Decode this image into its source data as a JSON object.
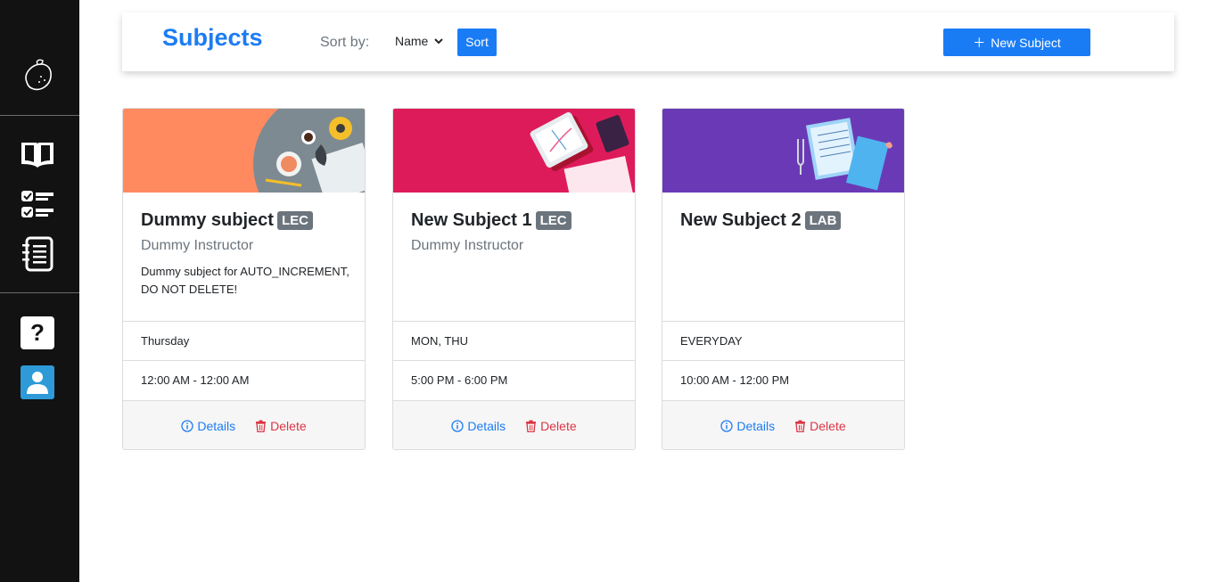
{
  "sidebar": {
    "logo_icon": "lemon-logo-icon",
    "nav_icons": [
      "book-icon",
      "checklist-icon",
      "notebook-icon"
    ],
    "help_label": "?",
    "profile_icon": "user-icon"
  },
  "header": {
    "title": "Subjects",
    "sort_label": "Sort by:",
    "sort_value": "Name",
    "sort_button": "Sort",
    "new_button": "New Subject",
    "new_icon": "plus-icon"
  },
  "colors": {
    "accent": "#1a7cf5",
    "sidebar": "#121212",
    "delete": "#dc3545",
    "badge": "#6c757d"
  },
  "cards": [
    {
      "title": "Dummy subject",
      "type": "LEC",
      "instructor": "Dummy Instructor",
      "description": "Dummy subject for AUTO_INCREMENT, DO NOT DELETE!",
      "days": "Thursday",
      "time": "12:00 AM - 12:00 AM",
      "details": "Details",
      "delete": "Delete",
      "banner_color": "#ff8a60"
    },
    {
      "title": "New Subject 1",
      "type": "LEC",
      "instructor": "Dummy Instructor",
      "description": "",
      "days": "MON, THU",
      "time": "5:00 PM - 6:00 PM",
      "details": "Details",
      "delete": "Delete",
      "banner_color": "#de1b5a"
    },
    {
      "title": "New Subject 2",
      "type": "LAB",
      "instructor": "",
      "description": "",
      "days": "EVERYDAY",
      "time": "10:00 AM - 12:00 PM",
      "details": "Details",
      "delete": "Delete",
      "banner_color": "#6a3ab6"
    }
  ]
}
